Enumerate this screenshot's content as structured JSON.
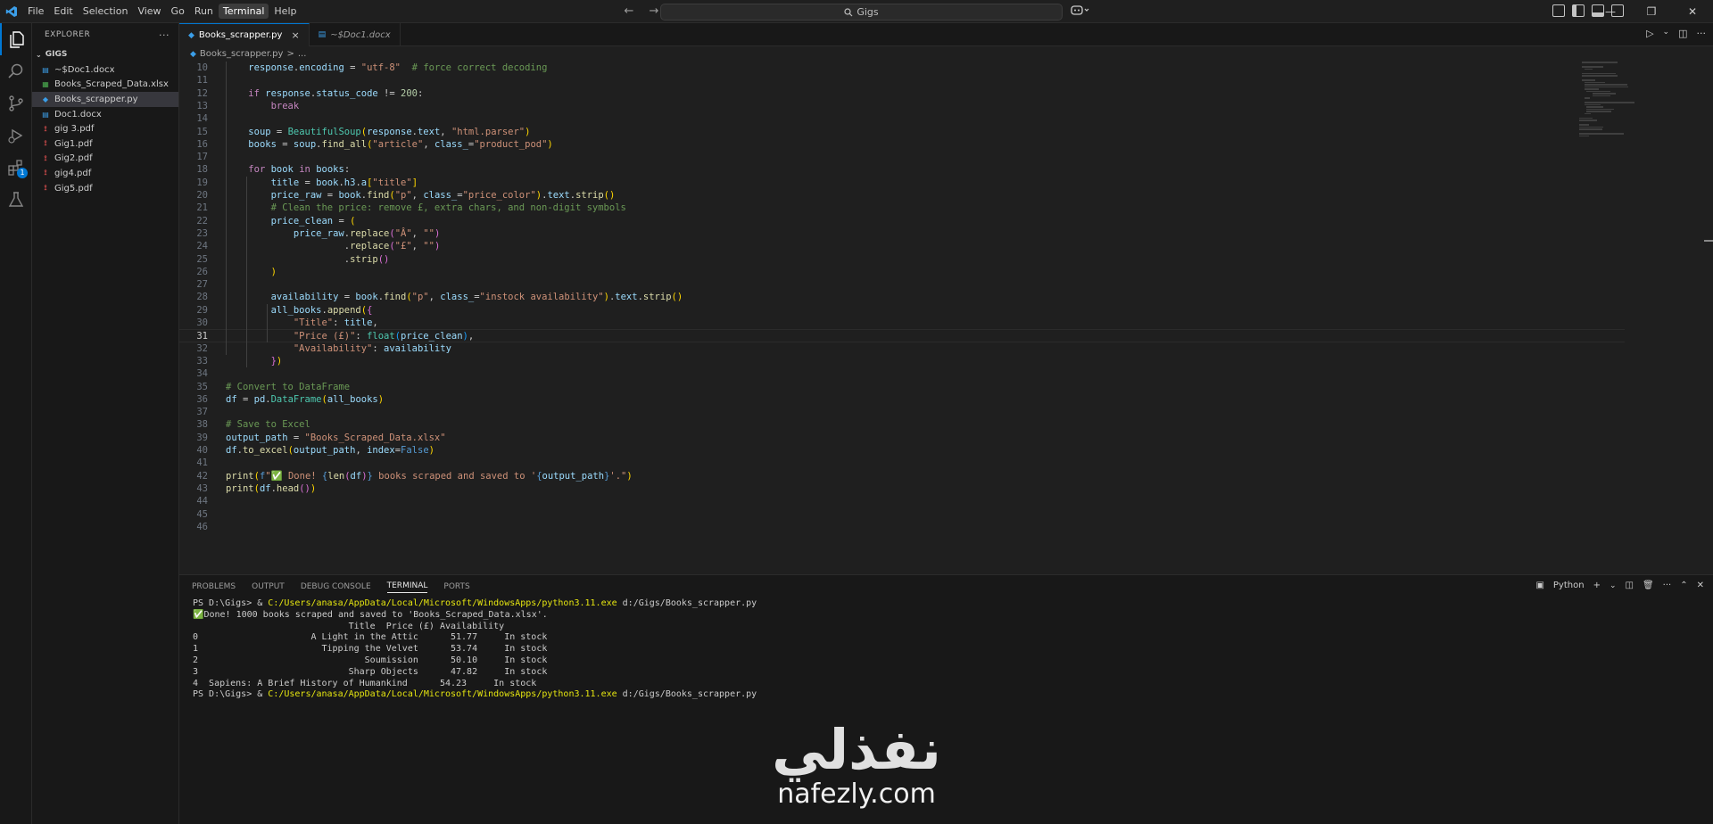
{
  "titlebar": {
    "menu": [
      "File",
      "Edit",
      "Selection",
      "View",
      "Go",
      "Run",
      "Terminal",
      "Help"
    ],
    "active_menu": "Terminal",
    "search": "Gigs"
  },
  "explorer": {
    "title": "EXPLORER",
    "more": "···",
    "folder": "GIGS",
    "files": [
      {
        "name": "~$Doc1.docx",
        "type": "docx"
      },
      {
        "name": "Books_Scraped_Data.xlsx",
        "type": "xlsx"
      },
      {
        "name": "Books_scrapper.py",
        "type": "py"
      },
      {
        "name": "Doc1.docx",
        "type": "docx"
      },
      {
        "name": "gig 3.pdf",
        "type": "pdf"
      },
      {
        "name": "Gig1.pdf",
        "type": "pdf"
      },
      {
        "name": "Gig2.pdf",
        "type": "pdf"
      },
      {
        "name": "gig4.pdf",
        "type": "pdf"
      },
      {
        "name": "Gig5.pdf",
        "type": "pdf"
      }
    ],
    "selected_index": 2,
    "extensions_badge": "1"
  },
  "tabs": [
    {
      "label": "Books_scrapper.py",
      "active": true,
      "close": "×"
    },
    {
      "label": "~$Doc1.docx",
      "active": false,
      "close": ""
    }
  ],
  "breadcrumb": {
    "file": "Books_scrapper.py",
    "sep": ">",
    "rest": "..."
  },
  "editor": {
    "current_line": 31,
    "lines": [
      {
        "n": 10,
        "html": "    <span class='var'>response</span>.<span class='var'>encoding</span> = <span class='str'>\"utf-8\"</span>  <span class='com'># force correct decoding</span>"
      },
      {
        "n": 11,
        "html": ""
      },
      {
        "n": 12,
        "html": "    <span class='kw'>if</span> <span class='var'>response</span>.<span class='var'>status_code</span> != <span class='num'>200</span>:"
      },
      {
        "n": 13,
        "html": "        <span class='kw'>break</span>"
      },
      {
        "n": 14,
        "html": ""
      },
      {
        "n": 15,
        "html": "    <span class='var'>soup</span> = <span class='cls'>BeautifulSoup</span><span class='br1'>(</span><span class='var'>response</span>.<span class='var'>text</span>, <span class='str'>\"html.parser\"</span><span class='br1'>)</span>"
      },
      {
        "n": 16,
        "html": "    <span class='var'>books</span> = <span class='var'>soup</span>.<span class='fn'>find_all</span><span class='br1'>(</span><span class='str'>\"article\"</span>, <span class='var'>class_</span>=<span class='str'>\"product_pod\"</span><span class='br1'>)</span>"
      },
      {
        "n": 17,
        "html": ""
      },
      {
        "n": 18,
        "html": "    <span class='kw'>for</span> <span class='var'>book</span> <span class='kw'>in</span> <span class='var'>books</span>:"
      },
      {
        "n": 19,
        "html": "        <span class='var'>title</span> = <span class='var'>book</span>.<span class='var'>h3</span>.<span class='var'>a</span><span class='br1'>[</span><span class='str'>\"title\"</span><span class='br1'>]</span>"
      },
      {
        "n": 20,
        "html": "        <span class='var'>price_raw</span> = <span class='var'>book</span>.<span class='fn'>find</span><span class='br1'>(</span><span class='str'>\"p\"</span>, <span class='var'>class_</span>=<span class='str'>\"price_color\"</span><span class='br1'>)</span>.<span class='var'>text</span>.<span class='fn'>strip</span><span class='br1'>()</span>"
      },
      {
        "n": 21,
        "html": "        <span class='com'># Clean the price: remove £, extra chars, and non-digit symbols</span>"
      },
      {
        "n": 22,
        "html": "        <span class='var'>price_clean</span> = <span class='br1'>(</span>"
      },
      {
        "n": 23,
        "html": "            <span class='var'>price_raw</span>.<span class='fn'>replace</span><span class='br2'>(</span><span class='str'>\"Â\"</span>, <span class='str'>\"\"</span><span class='br2'>)</span>"
      },
      {
        "n": 24,
        "html": "                     .<span class='fn'>replace</span><span class='br2'>(</span><span class='str'>\"£\"</span>, <span class='str'>\"\"</span><span class='br2'>)</span>"
      },
      {
        "n": 25,
        "html": "                     .<span class='fn'>strip</span><span class='br2'>()</span>"
      },
      {
        "n": 26,
        "html": "        <span class='br1'>)</span>"
      },
      {
        "n": 27,
        "html": ""
      },
      {
        "n": 28,
        "html": "        <span class='var'>availability</span> = <span class='var'>book</span>.<span class='fn'>find</span><span class='br1'>(</span><span class='str'>\"p\"</span>, <span class='var'>class_</span>=<span class='str'>\"instock availability\"</span><span class='br1'>)</span>.<span class='var'>text</span>.<span class='fn'>strip</span><span class='br1'>()</span>"
      },
      {
        "n": 29,
        "html": "        <span class='var'>all_books</span>.<span class='fn'>append</span><span class='br1'>(</span><span class='br2'>{</span>"
      },
      {
        "n": 30,
        "html": "            <span class='str'>\"Title\"</span>: <span class='var'>title</span>,"
      },
      {
        "n": 31,
        "html": "            <span class='str'>\"Price (£)\"</span>: <span class='cls'>float</span><span class='br3'>(</span><span class='var'>price_clean</span><span class='br3'>)</span>,"
      },
      {
        "n": 32,
        "html": "            <span class='str'>\"Availability\"</span>: <span class='var'>availability</span>"
      },
      {
        "n": 33,
        "html": "        <span class='br2'>}</span><span class='br1'>)</span>"
      },
      {
        "n": 34,
        "html": ""
      },
      {
        "n": 35,
        "html": "<span class='com'># Convert to DataFrame</span>"
      },
      {
        "n": 36,
        "html": "<span class='var'>df</span> = <span class='var'>pd</span>.<span class='cls'>DataFrame</span><span class='br1'>(</span><span class='var'>all_books</span><span class='br1'>)</span>"
      },
      {
        "n": 37,
        "html": ""
      },
      {
        "n": 38,
        "html": "<span class='com'># Save to Excel</span>"
      },
      {
        "n": 39,
        "html": "<span class='var'>output_path</span> = <span class='str'>\"Books_Scraped_Data.xlsx\"</span>"
      },
      {
        "n": 40,
        "html": "<span class='var'>df</span>.<span class='fn'>to_excel</span><span class='br1'>(</span><span class='var'>output_path</span>, <span class='var'>index</span>=<span class='const'>False</span><span class='br1'>)</span>"
      },
      {
        "n": 41,
        "html": ""
      },
      {
        "n": 42,
        "html": "<span class='fn'>print</span><span class='br1'>(</span><span class='const'>f</span><span class='str'>\"✅ Done! </span><span class='const'>{</span><span class='fn'>len</span><span class='br2'>(</span><span class='var'>df</span><span class='br2'>)</span><span class='const'>}</span><span class='str'> books scraped and saved to '</span><span class='const'>{</span><span class='var'>output_path</span><span class='const'>}</span><span class='str'>'.\"</span><span class='br1'>)</span>"
      },
      {
        "n": 43,
        "html": "<span class='fn'>print</span><span class='br1'>(</span><span class='var'>df</span>.<span class='fn'>head</span><span class='br2'>()</span><span class='br1'>)</span>"
      },
      {
        "n": 44,
        "html": ""
      },
      {
        "n": 45,
        "html": ""
      },
      {
        "n": 46,
        "html": ""
      }
    ]
  },
  "panel": {
    "tabs": [
      "PROBLEMS",
      "OUTPUT",
      "DEBUG CONSOLE",
      "TERMINAL",
      "PORTS"
    ],
    "active_tab": "TERMINAL",
    "shell_label": "Python",
    "terminal": {
      "prompt": "PS D:\\Gigs> & ",
      "exe": "C:/Users/anasa/AppData/Local/Microsoft/WindowsApps/python3.11.exe",
      "script": " d:/Gigs/Books_scrapper.py",
      "check": "✅",
      "done": "Done! 1000 books scraped and saved to 'Books_Scraped_Data.xlsx'.",
      "header": "                             Title  Price (£) Availability",
      "rows": [
        "0                     A Light in the Attic      51.77     In stock",
        "1                       Tipping the Velvet      53.74     In stock",
        "2                               Soumission      50.10     In stock",
        "3                            Sharp Objects      47.82     In stock",
        "4  Sapiens: A Brief History of Humankind      54.23     In stock"
      ]
    }
  },
  "watermark": {
    "logo": "نفذلي",
    "url": "nafezly.com"
  }
}
